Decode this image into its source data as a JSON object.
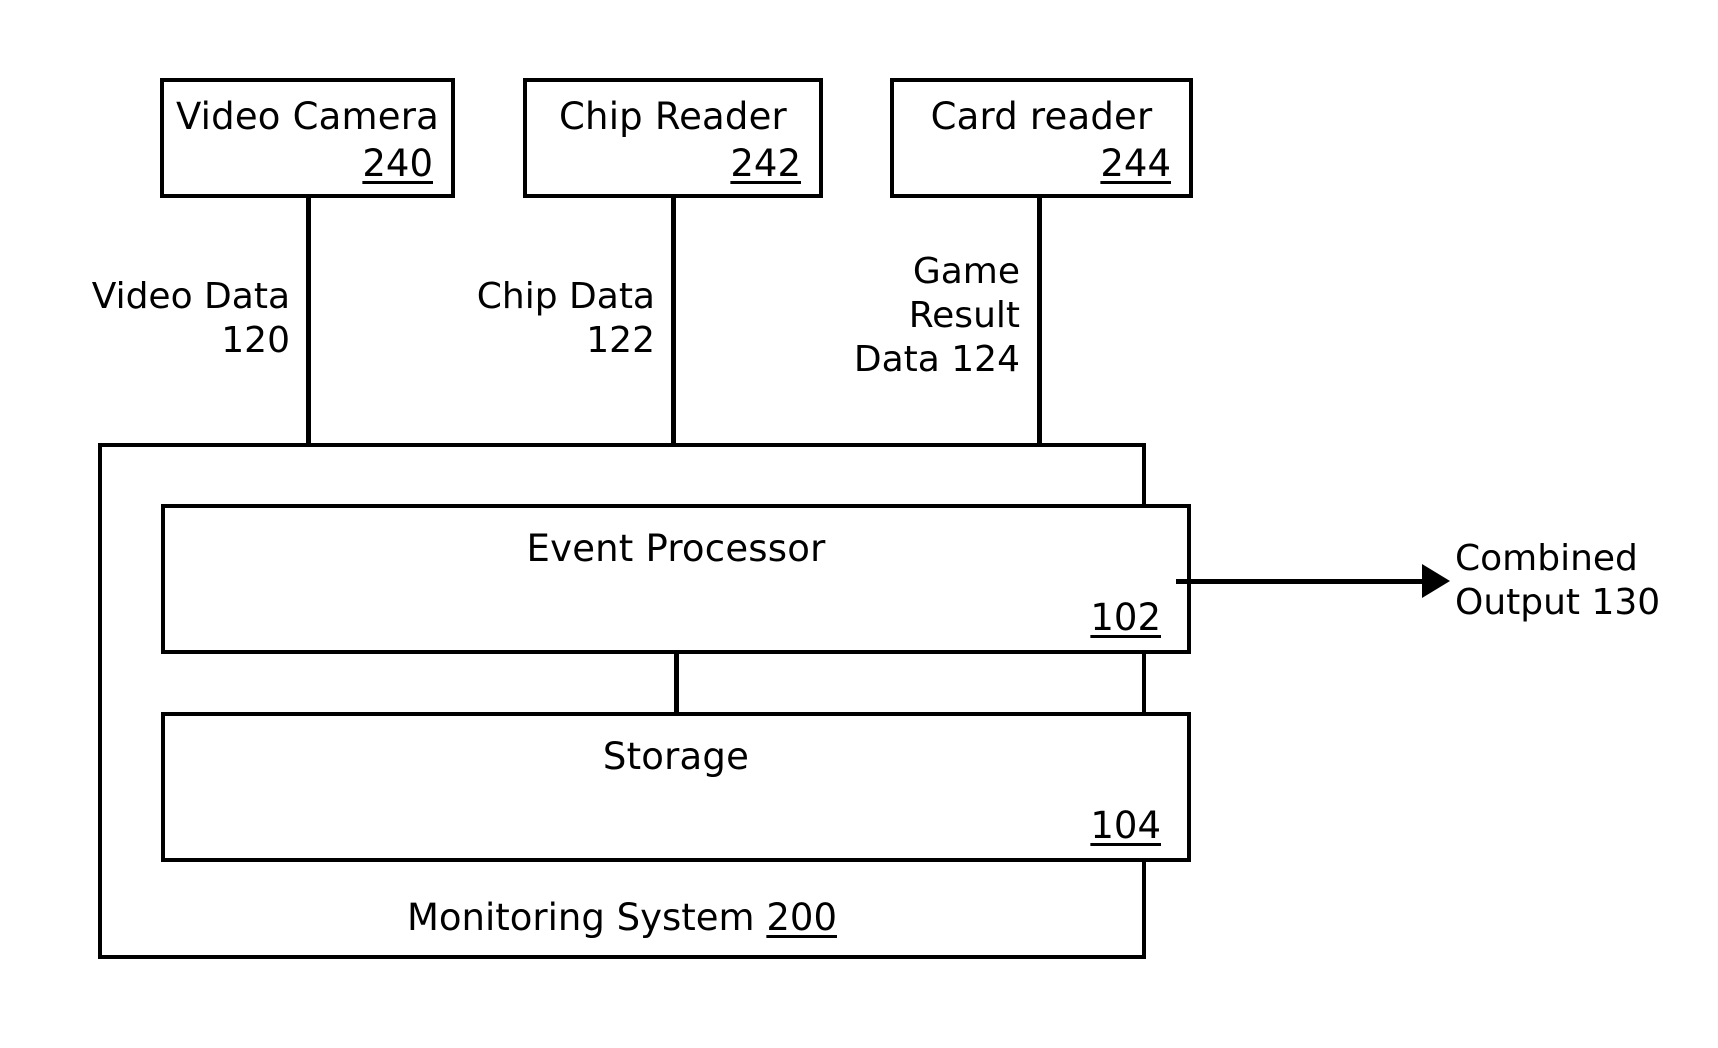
{
  "diagram": {
    "sources": [
      {
        "label": "Video Camera",
        "ref": "240"
      },
      {
        "label": "Chip Reader",
        "ref": "242"
      },
      {
        "label": "Card reader",
        "ref": "244"
      }
    ],
    "flow_labels": [
      {
        "text": "Video Data\n120"
      },
      {
        "text": "Chip Data\n122"
      },
      {
        "text": "Game\nResult\nData 124"
      }
    ],
    "system": {
      "label": "Monitoring System ",
      "ref": "200",
      "components": [
        {
          "label": "Event Processor",
          "ref": "102"
        },
        {
          "label": "Storage",
          "ref": "104"
        }
      ]
    },
    "output": {
      "text": "Combined\nOutput 130"
    },
    "colors": {
      "stroke": "#000000",
      "background": "#ffffff"
    }
  }
}
